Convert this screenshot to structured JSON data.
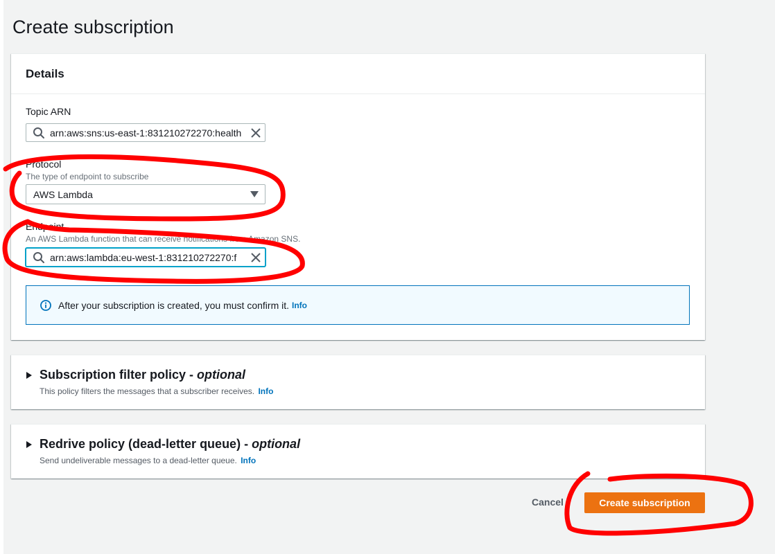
{
  "page": {
    "title": "Create subscription"
  },
  "details": {
    "header": "Details",
    "topic_arn": {
      "label": "Topic ARN",
      "value": "arn:aws:sns:us-east-1:831210272270:health"
    },
    "protocol": {
      "label": "Protocol",
      "description": "The type of endpoint to subscribe",
      "value": "AWS Lambda"
    },
    "endpoint": {
      "label": "Endpoint",
      "description": "An AWS Lambda function that can receive notifications from Amazon SNS.",
      "value": "arn:aws:lambda:eu-west-1:831210272270:f"
    },
    "alert": {
      "text": "After your subscription is created, you must confirm it.",
      "link": "Info"
    }
  },
  "filter_policy": {
    "title": "Subscription filter policy -",
    "optional": "optional",
    "description": "This policy filters the messages that a subscriber receives.",
    "link": "Info"
  },
  "redrive_policy": {
    "title": "Redrive policy (dead-letter queue) -",
    "optional": "optional",
    "description": "Send undeliverable messages to a dead-letter queue.",
    "link": "Info"
  },
  "actions": {
    "cancel": "Cancel",
    "create": "Create subscription"
  },
  "icons": {
    "search": "search-icon",
    "clear": "close-icon",
    "dropdown": "caret-down-icon",
    "info": "info-icon",
    "expand": "caret-right-icon"
  },
  "colors": {
    "primary_button": "#ec7211",
    "link": "#0073bb",
    "focus": "#00a1c9",
    "annotation": "#ff0000"
  }
}
